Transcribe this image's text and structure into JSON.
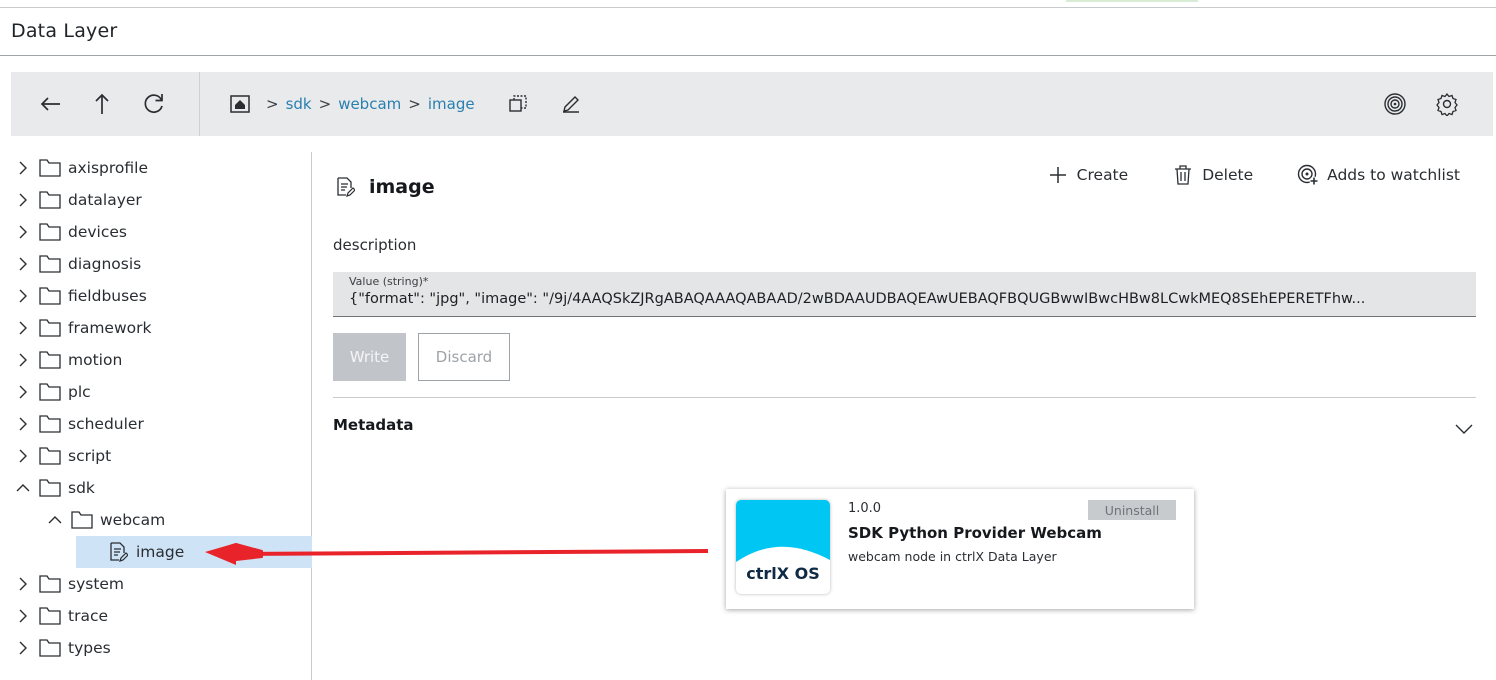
{
  "app": {
    "title": "Data Layer"
  },
  "toolbar": {
    "breadcrumb": [
      "sdk",
      "webcam",
      "image"
    ]
  },
  "tree": {
    "items": [
      {
        "label": "axisprofile",
        "state": "collapsed"
      },
      {
        "label": "datalayer",
        "state": "collapsed"
      },
      {
        "label": "devices",
        "state": "collapsed"
      },
      {
        "label": "diagnosis",
        "state": "collapsed"
      },
      {
        "label": "fieldbuses",
        "state": "collapsed"
      },
      {
        "label": "framework",
        "state": "collapsed"
      },
      {
        "label": "motion",
        "state": "collapsed"
      },
      {
        "label": "plc",
        "state": "collapsed"
      },
      {
        "label": "scheduler",
        "state": "collapsed"
      },
      {
        "label": "script",
        "state": "collapsed"
      },
      {
        "label": "sdk",
        "state": "expanded"
      },
      {
        "label": "webcam",
        "state": "expanded"
      },
      {
        "label": "image",
        "state": "selected"
      },
      {
        "label": "system",
        "state": "collapsed"
      },
      {
        "label": "trace",
        "state": "collapsed"
      },
      {
        "label": "types",
        "state": "collapsed"
      }
    ]
  },
  "node": {
    "title": "image",
    "actions": {
      "create": "Create",
      "delete": "Delete",
      "watch": "Adds to watchlist"
    },
    "description_label": "description",
    "value_label": "Value (string)*",
    "value": "{\"format\": \"jpg\", \"image\": \"/9j/4AAQSkZJRgABAQAAAQABAAD/2wBDAAUDBAQEAwUEBAQFBQUGBwwIBwcHBw8LCwkMEQ8SEhEPERETFhw...",
    "write_label": "Write",
    "discard_label": "Discard",
    "metadata_label": "Metadata"
  },
  "card": {
    "version": "1.0.0",
    "name": "SDK Python Provider Webcam",
    "description": "webcam node in ctrlX Data Layer",
    "uninstall": "Uninstall",
    "logo_text": "ctrlX OS"
  },
  "colors": {
    "link": "#2a7fb0",
    "selected": "#cfe3f7",
    "arrow": "#e8232a",
    "logo": "#00c6f3"
  }
}
